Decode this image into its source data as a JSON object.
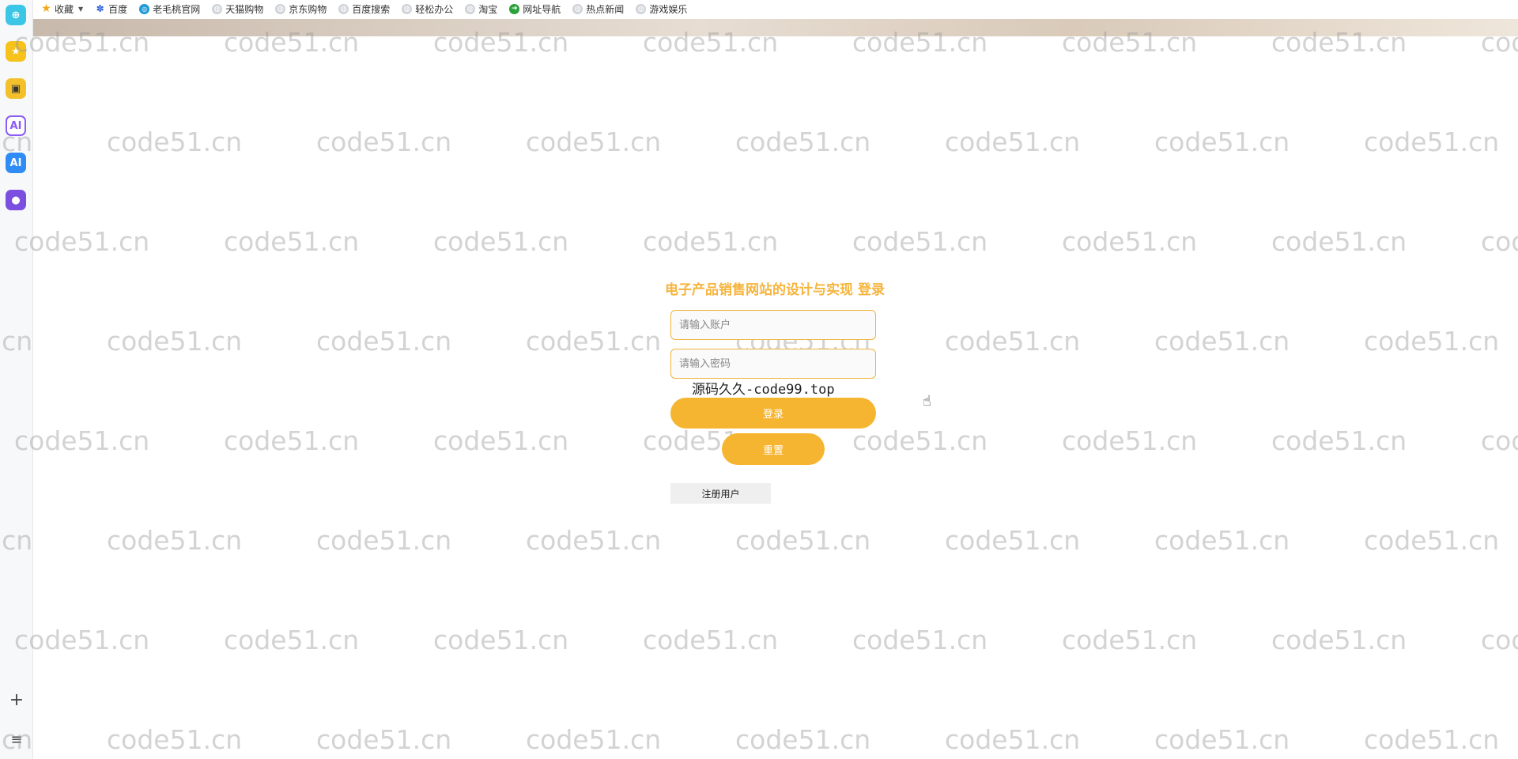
{
  "bookmarks": {
    "items": [
      {
        "label": "收藏",
        "icon": "star-icon"
      },
      {
        "label": "百度",
        "icon": "baidu-paw-icon"
      },
      {
        "label": "老毛桃官网",
        "icon": "globe-icon"
      },
      {
        "label": "天猫购物",
        "icon": "globe-icon"
      },
      {
        "label": "京东购物",
        "icon": "globe-icon"
      },
      {
        "label": "百度搜索",
        "icon": "globe-icon"
      },
      {
        "label": "轻松办公",
        "icon": "globe-icon"
      },
      {
        "label": "淘宝",
        "icon": "globe-icon"
      },
      {
        "label": "网址导航",
        "icon": "nav-icon"
      },
      {
        "label": "热点新闻",
        "icon": "globe-icon"
      },
      {
        "label": "游戏娱乐",
        "icon": "globe-icon"
      }
    ]
  },
  "sidebar": {
    "ai_label": "AI",
    "add_symbol": "+",
    "menu_symbol": "≡"
  },
  "watermark": "code51.cn",
  "login": {
    "title": "电子产品销售网站的设计与实现 登录",
    "username_placeholder": "请输入账户",
    "password_placeholder": "请输入密码",
    "overlay_text": "源码久久-code99.top",
    "login_label": "登录",
    "reset_label": "重置",
    "register_label": "注册用户"
  },
  "colors": {
    "accent": "#f6b531",
    "title": "#f6b43c",
    "input_border": "#f0b33d"
  }
}
